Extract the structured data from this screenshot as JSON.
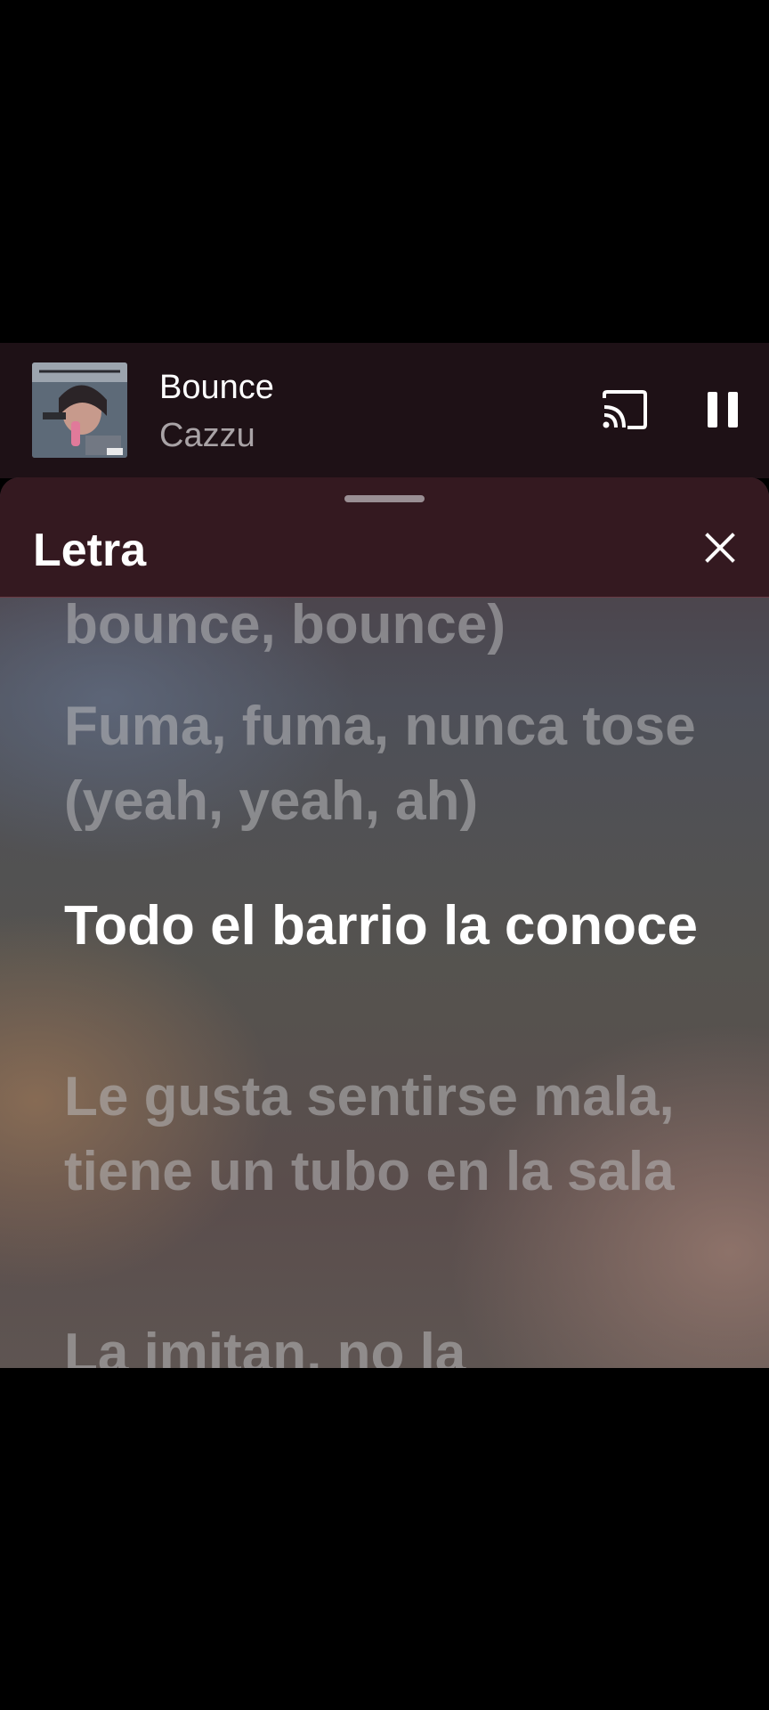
{
  "now_playing": {
    "title": "Bounce",
    "artist": "Cazzu",
    "cast_icon": "cast-icon",
    "pause_icon": "pause-icon"
  },
  "lyrics_sheet": {
    "title": "Letra",
    "close_icon": "close-icon",
    "lines": [
      {
        "text": "bounce, bounce)",
        "active": false
      },
      {
        "text": "Fuma, fuma, nunca tose (yeah, yeah, ah)",
        "active": false
      },
      {
        "text": "Todo el barrio la conoce",
        "active": true
      },
      {
        "text": "Le gusta sentirse mala, tiene un tubo en la sala",
        "active": false
      },
      {
        "text": "La imitan, no la",
        "active": false
      }
    ]
  },
  "colors": {
    "mini_player_bg": "#1e1116",
    "sheet_header_bg": "#341920",
    "active_lyric": "#ffffff",
    "inactive_lyric": "#b9b9bc"
  }
}
